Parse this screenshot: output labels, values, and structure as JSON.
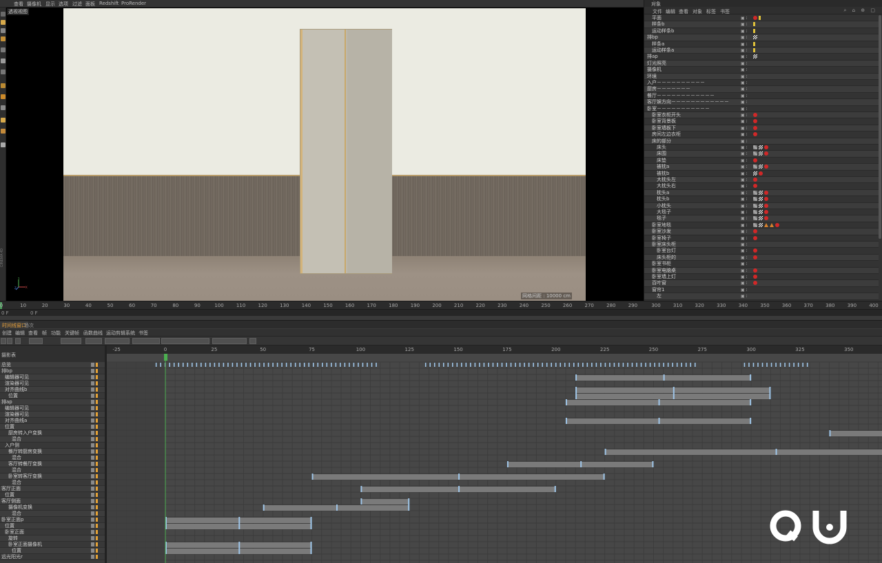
{
  "menubar": {
    "items": [
      "查看",
      "摄像机",
      "显示",
      "选项",
      "过滤",
      "面板",
      "Redshift",
      "ProRender"
    ]
  },
  "viewport": {
    "label": "透视视图",
    "grid_readout": "网格间距 : 10000 cm"
  },
  "viewport_ruler": {
    "ticks": [
      "0",
      "10",
      "20",
      "30",
      "40",
      "50",
      "60",
      "70",
      "80",
      "90",
      "100",
      "110",
      "120",
      "130",
      "140",
      "150",
      "160",
      "170",
      "180",
      "190",
      "200",
      "210",
      "220",
      "230",
      "240",
      "250",
      "260",
      "270",
      "280",
      "290"
    ]
  },
  "object_ruler": {
    "ticks": [
      "300",
      "310",
      "320",
      "330",
      "340",
      "350",
      "360",
      "370",
      "380",
      "390",
      "400"
    ]
  },
  "frame_row": {
    "left": "0 F",
    "mid": "0 F"
  },
  "object_manager": {
    "title": "对象",
    "menu": [
      "文件",
      "编辑",
      "查看",
      "对象",
      "标签",
      "书签"
    ],
    "rows": [
      {
        "name": "平面",
        "indent": 1,
        "tags": [
          "r",
          "y"
        ]
      },
      {
        "name": "样条b",
        "indent": 1,
        "tags": [
          "y"
        ]
      },
      {
        "name": "运动样条b",
        "indent": 1,
        "tags": [
          "y"
        ]
      },
      {
        "name": "排bp",
        "indent": 0,
        "tags": [
          "x"
        ]
      },
      {
        "name": "样条a",
        "indent": 1,
        "tags": [
          "y"
        ]
      },
      {
        "name": "运动样条a",
        "indent": 1,
        "tags": [
          "y"
        ]
      },
      {
        "name": "排ap",
        "indent": 0,
        "tags": [
          "x"
        ]
      },
      {
        "name": "灯光照亮",
        "indent": 0,
        "tags": []
      },
      {
        "name": "摄像机",
        "indent": 0,
        "tags": []
      },
      {
        "name": "环境",
        "indent": 0,
        "tags": []
      },
      {
        "name": "入户－－－－－－－－－－",
        "indent": 0,
        "tags": []
      },
      {
        "name": "厨房－－－－－－－",
        "indent": 0,
        "tags": []
      },
      {
        "name": "餐厅－－－－－－－－－－－－",
        "indent": 0,
        "tags": []
      },
      {
        "name": "客厅娱方向－－－－－－－－－－－－",
        "indent": 0,
        "tags": []
      },
      {
        "name": "卧室－－－－－－－－－－－",
        "indent": 0,
        "tags": []
      },
      {
        "name": "卧室衣柜开头",
        "indent": 1,
        "tags": [
          "r"
        ]
      },
      {
        "name": "卧室背景板",
        "indent": 1,
        "tags": [
          "r"
        ]
      },
      {
        "name": "卧室墙板下",
        "indent": 1,
        "tags": [
          "r"
        ]
      },
      {
        "name": "房间左边衣柜",
        "indent": 1,
        "tags": [
          "r"
        ]
      },
      {
        "name": "床的部分",
        "indent": 1,
        "tags": []
      },
      {
        "name": "床头",
        "indent": 2,
        "tags": [
          "t",
          "c",
          "r"
        ]
      },
      {
        "name": "床围",
        "indent": 2,
        "tags": [
          "t",
          "c",
          "r"
        ]
      },
      {
        "name": "床垫",
        "indent": 2,
        "tags": [
          "r"
        ]
      },
      {
        "name": "被枕a",
        "indent": 2,
        "tags": [
          "t",
          "c",
          "r"
        ]
      },
      {
        "name": "被枕b",
        "indent": 2,
        "tags": [
          "c",
          "r"
        ]
      },
      {
        "name": "大枕头左",
        "indent": 2,
        "tags": [
          "r"
        ]
      },
      {
        "name": "大枕头右",
        "indent": 2,
        "tags": [
          "r"
        ]
      },
      {
        "name": "枕头a",
        "indent": 2,
        "tags": [
          "t",
          "c",
          "r"
        ]
      },
      {
        "name": "枕头b",
        "indent": 2,
        "tags": [
          "t",
          "c",
          "r"
        ]
      },
      {
        "name": "小枕头",
        "indent": 2,
        "tags": [
          "t",
          "c",
          "r"
        ]
      },
      {
        "name": "大毯子",
        "indent": 2,
        "tags": [
          "t",
          "c",
          "r"
        ]
      },
      {
        "name": "毯子",
        "indent": 2,
        "tags": [
          "t",
          "c",
          "r"
        ]
      },
      {
        "name": "卧室地毯",
        "indent": 1,
        "tags": [
          "t",
          "c",
          "tri",
          "tri",
          "r"
        ]
      },
      {
        "name": "卧室沙发",
        "indent": 1,
        "tags": [
          "r"
        ]
      },
      {
        "name": "卧室椅子",
        "indent": 1,
        "tags": [
          "r"
        ]
      },
      {
        "name": "卧室床头柜",
        "indent": 1,
        "tags": []
      },
      {
        "name": "卧室台灯",
        "indent": 2,
        "tags": [
          "r"
        ]
      },
      {
        "name": "床头柜的",
        "indent": 2,
        "tags": [
          "r"
        ]
      },
      {
        "name": "卧室书柜",
        "indent": 1,
        "tags": []
      },
      {
        "name": "卧室电脑桌",
        "indent": 1,
        "tags": [
          "r"
        ]
      },
      {
        "name": "卧室墙上灯",
        "indent": 1,
        "tags": [
          "r"
        ]
      },
      {
        "name": "百叶窗",
        "indent": 1,
        "tags": [
          "r"
        ]
      },
      {
        "name": "窗帘1",
        "indent": 1,
        "tags": []
      },
      {
        "name": "左",
        "indent": 2,
        "tags": []
      }
    ]
  },
  "timeline": {
    "tabs": [
      "时间线窗口",
      "场次"
    ],
    "menu": [
      "创建",
      "编辑",
      "查看",
      "帧",
      "功能",
      "关键帧",
      "函数曲线",
      "运动剪辑系统",
      "书签"
    ],
    "header": "摄影表",
    "ruler": [
      "-25",
      "0",
      "25",
      "50",
      "75",
      "100",
      "125",
      "150",
      "175",
      "200",
      "225",
      "250",
      "275",
      "300",
      "325",
      "350"
    ],
    "rows": [
      {
        "name": "总览",
        "indent": 0
      },
      {
        "name": "排bp",
        "indent": 0
      },
      {
        "name": "编辑器可见",
        "indent": 1
      },
      {
        "name": "渲染器可见",
        "indent": 1
      },
      {
        "name": "对齐曲线b",
        "indent": 1
      },
      {
        "name": "位置",
        "indent": 2
      },
      {
        "name": "排ap",
        "indent": 0
      },
      {
        "name": "编辑器可见",
        "indent": 1
      },
      {
        "name": "渲染器可见",
        "indent": 1
      },
      {
        "name": "对齐曲线a",
        "indent": 1
      },
      {
        "name": "位置",
        "indent": 1
      },
      {
        "name": "厨房转入户变换",
        "indent": 2
      },
      {
        "name": "混合",
        "indent": 3
      },
      {
        "name": "入户侧",
        "indent": 1
      },
      {
        "name": "餐厅转厨房变换",
        "indent": 2
      },
      {
        "name": "混合",
        "indent": 3
      },
      {
        "name": "客厅转餐厅变换",
        "indent": 2
      },
      {
        "name": "混合",
        "indent": 3
      },
      {
        "name": "卧室转客厅变换",
        "indent": 2
      },
      {
        "name": "混合",
        "indent": 3
      },
      {
        "name": "客厅正面",
        "indent": 0
      },
      {
        "name": "位置",
        "indent": 1
      },
      {
        "name": "客厅侧面",
        "indent": 0
      },
      {
        "name": "摄像机变换",
        "indent": 2
      },
      {
        "name": "混合",
        "indent": 3
      },
      {
        "name": "卧室正面p",
        "indent": 0
      },
      {
        "name": "位置",
        "indent": 1
      },
      {
        "name": "卧室正面",
        "indent": 1
      },
      {
        "name": "旋转",
        "indent": 2
      },
      {
        "name": "卧室正面摄像机",
        "indent": 2
      },
      {
        "name": "位置",
        "indent": 3
      },
      {
        "name": "远光阳光r",
        "indent": 0
      }
    ],
    "bars": [
      {
        "row": 2,
        "segments": [
          [
            210,
            300
          ]
        ]
      },
      {
        "row": 4,
        "segments": [
          [
            210,
            310
          ]
        ]
      },
      {
        "row": 5,
        "segments": [
          [
            210,
            310
          ]
        ]
      },
      {
        "row": 6,
        "segments": [
          [
            205,
            300
          ]
        ]
      },
      {
        "row": 9,
        "segments": [
          [
            205,
            300
          ]
        ]
      },
      {
        "row": 11,
        "segments": [
          [
            340,
            400
          ]
        ]
      },
      {
        "row": 14,
        "segments": [
          [
            225,
            400
          ]
        ]
      },
      {
        "row": 16,
        "segments": [
          [
            175,
            250
          ]
        ]
      },
      {
        "row": 18,
        "segments": [
          [
            75,
            225
          ]
        ]
      },
      {
        "row": 20,
        "segments": [
          [
            100,
            200
          ]
        ]
      },
      {
        "row": 22,
        "segments": [
          [
            100,
            125
          ]
        ]
      },
      {
        "row": 23,
        "segments": [
          [
            50,
            125
          ]
        ]
      },
      {
        "row": 25,
        "segments": [
          [
            0,
            75
          ]
        ]
      },
      {
        "row": 26,
        "segments": [
          [
            0,
            75
          ]
        ]
      },
      {
        "row": 29,
        "segments": [
          [
            0,
            75
          ]
        ]
      },
      {
        "row": 30,
        "segments": [
          [
            0,
            75
          ]
        ]
      }
    ],
    "range": [
      -30,
      367
    ]
  },
  "watermark": "QU",
  "colors": {
    "accent": "#e9a13a",
    "key": "#9ec5e8",
    "tag_red": "#d02828"
  }
}
